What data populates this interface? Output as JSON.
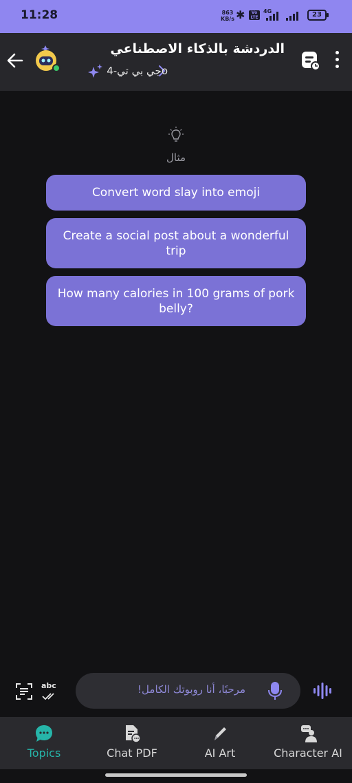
{
  "status_bar": {
    "time": "11:28",
    "net_speed_value": "863",
    "net_speed_unit": "KB/s",
    "network_type": "4G",
    "battery": "23"
  },
  "header": {
    "title": "الدردشة بالذكاء الاصطناعي",
    "model": "جي بي تي-4o"
  },
  "examples": {
    "label": "مثال",
    "items": [
      "Convert word slay into emoji",
      "Create a social post about a wonderful trip",
      "How many calories in 100 grams of pork belly?"
    ]
  },
  "input": {
    "placeholder": "مرحبًا، أنا روبوتك الكامل!",
    "spellcheck_label": "abc"
  },
  "nav": {
    "items": [
      {
        "label": "Topics",
        "icon": "chat-bubble-icon",
        "active": true
      },
      {
        "label": "Chat PDF",
        "icon": "pdf-chat-icon",
        "active": false
      },
      {
        "label": "AI Art",
        "icon": "pen-icon",
        "active": false
      },
      {
        "label": "Character AI",
        "icon": "character-icon",
        "active": false
      }
    ]
  },
  "colors": {
    "status_bar": "#8f86f0",
    "suggestion_bg": "#7b72d6",
    "active_nav": "#26b5a9",
    "accent": "#8e88f0"
  }
}
